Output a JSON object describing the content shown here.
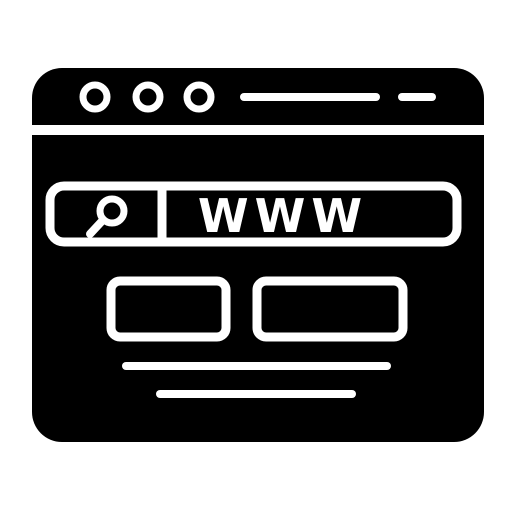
{
  "icon": {
    "name": "web-browser-icon",
    "foreground": "#000000",
    "background": "#ffffff",
    "window_controls": [
      {
        "name": "window-control-dot-1"
      },
      {
        "name": "window-control-dot-2"
      },
      {
        "name": "window-control-dot-3"
      }
    ],
    "address_bar": {
      "search_icon": "search-icon",
      "url_text": "WWW"
    },
    "content_boxes": 2,
    "text_lines": 2
  }
}
